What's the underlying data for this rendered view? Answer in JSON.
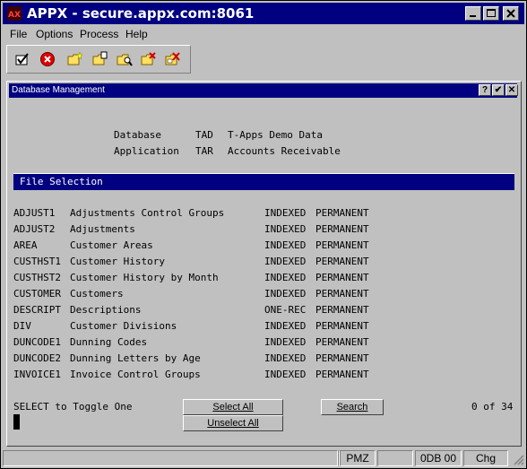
{
  "window": {
    "title": "APPX - secure.appx.com:8061"
  },
  "menu": [
    "File",
    "Options",
    "Process",
    "Help"
  ],
  "toolbar": {
    "icons": [
      "check-icon",
      "cancel-icon",
      "new-folder-icon",
      "edit-folder-icon",
      "inspect-folder-icon",
      "delete-folder-icon",
      "delete-marked-folder-icon"
    ]
  },
  "child": {
    "title": "Database Management",
    "controls": [
      "?",
      "✔",
      "✕"
    ]
  },
  "header": {
    "database_label": "Database",
    "database_code": "TAD",
    "database_name": "T-Apps Demo Data",
    "application_label": "Application",
    "application_code": "TAR",
    "application_name": "Accounts Receivable"
  },
  "section": {
    "title": "File Selection"
  },
  "files": [
    {
      "name": "ADJUST1",
      "desc": "Adjustments Control Groups",
      "org": "INDEXED",
      "type": "PERMANENT"
    },
    {
      "name": "ADJUST2",
      "desc": "Adjustments",
      "org": "INDEXED",
      "type": "PERMANENT"
    },
    {
      "name": "AREA",
      "desc": "Customer Areas",
      "org": "INDEXED",
      "type": "PERMANENT"
    },
    {
      "name": "CUSTHST1",
      "desc": "Customer History",
      "org": "INDEXED",
      "type": "PERMANENT"
    },
    {
      "name": "CUSTHST2",
      "desc": "Customer History by Month",
      "org": "INDEXED",
      "type": "PERMANENT"
    },
    {
      "name": "CUSTOMER",
      "desc": "Customers",
      "org": "INDEXED",
      "type": "PERMANENT"
    },
    {
      "name": "DESCRIPT",
      "desc": "Descriptions",
      "org": "ONE-REC",
      "type": "PERMANENT"
    },
    {
      "name": "DIV",
      "desc": "Customer Divisions",
      "org": "INDEXED",
      "type": "PERMANENT"
    },
    {
      "name": "DUNCODE1",
      "desc": "Dunning Codes",
      "org": "INDEXED",
      "type": "PERMANENT"
    },
    {
      "name": "DUNCODE2",
      "desc": "Dunning Letters by Age",
      "org": "INDEXED",
      "type": "PERMANENT"
    },
    {
      "name": "INVOICE1",
      "desc": "Invoice Control Groups",
      "org": "INDEXED",
      "type": "PERMANENT"
    }
  ],
  "footer": {
    "hint": "SELECT to Toggle One",
    "select_all": "Select All",
    "unselect_all": "Unselect All",
    "search": "Search",
    "count": "0 of 34"
  },
  "status": {
    "p1": "",
    "p2": "",
    "p3": "PMZ",
    "p4": "",
    "p5": "0DB 00",
    "p6": "Chg"
  },
  "colors": {
    "titlebar": "#000080",
    "face": "#c0c0c0"
  }
}
